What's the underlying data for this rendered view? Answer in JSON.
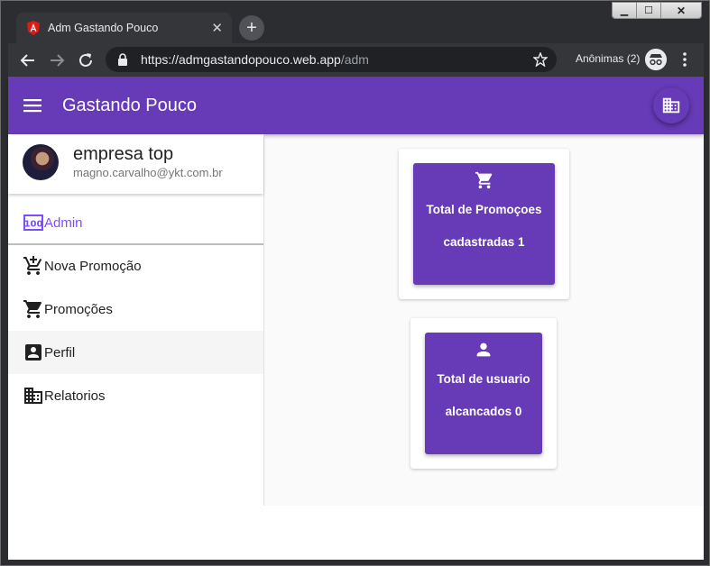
{
  "browser": {
    "tab_title": "Adm Gastando Pouco",
    "url_host": "https://admgastandopouco.web.app",
    "url_path": "/adm",
    "incognito_label": "Anônimas (2)"
  },
  "app": {
    "title": "Gastando Pouco",
    "brand_color": "#673ab7",
    "accent_color": "#7c4dff"
  },
  "profile": {
    "name": "empresa top",
    "email": "magno.carvalho@ykt.com.br"
  },
  "sidebar": {
    "items": [
      {
        "label": "Admin",
        "icon": "dashboard-100-icon"
      },
      {
        "label": "Nova Promoção",
        "icon": "add-shopping-cart-icon"
      },
      {
        "label": "Promoções",
        "icon": "shopping-cart-icon"
      },
      {
        "label": "Perfil",
        "icon": "account-box-icon"
      },
      {
        "label": "Relatorios",
        "icon": "business-icon"
      }
    ]
  },
  "cards": [
    {
      "icon": "shopping-cart-icon",
      "line1": "Total de Promoçoes",
      "line2": "cadastradas 1"
    },
    {
      "icon": "person-icon",
      "line1": "Total de usuario",
      "line2": "alcancados 0"
    }
  ]
}
